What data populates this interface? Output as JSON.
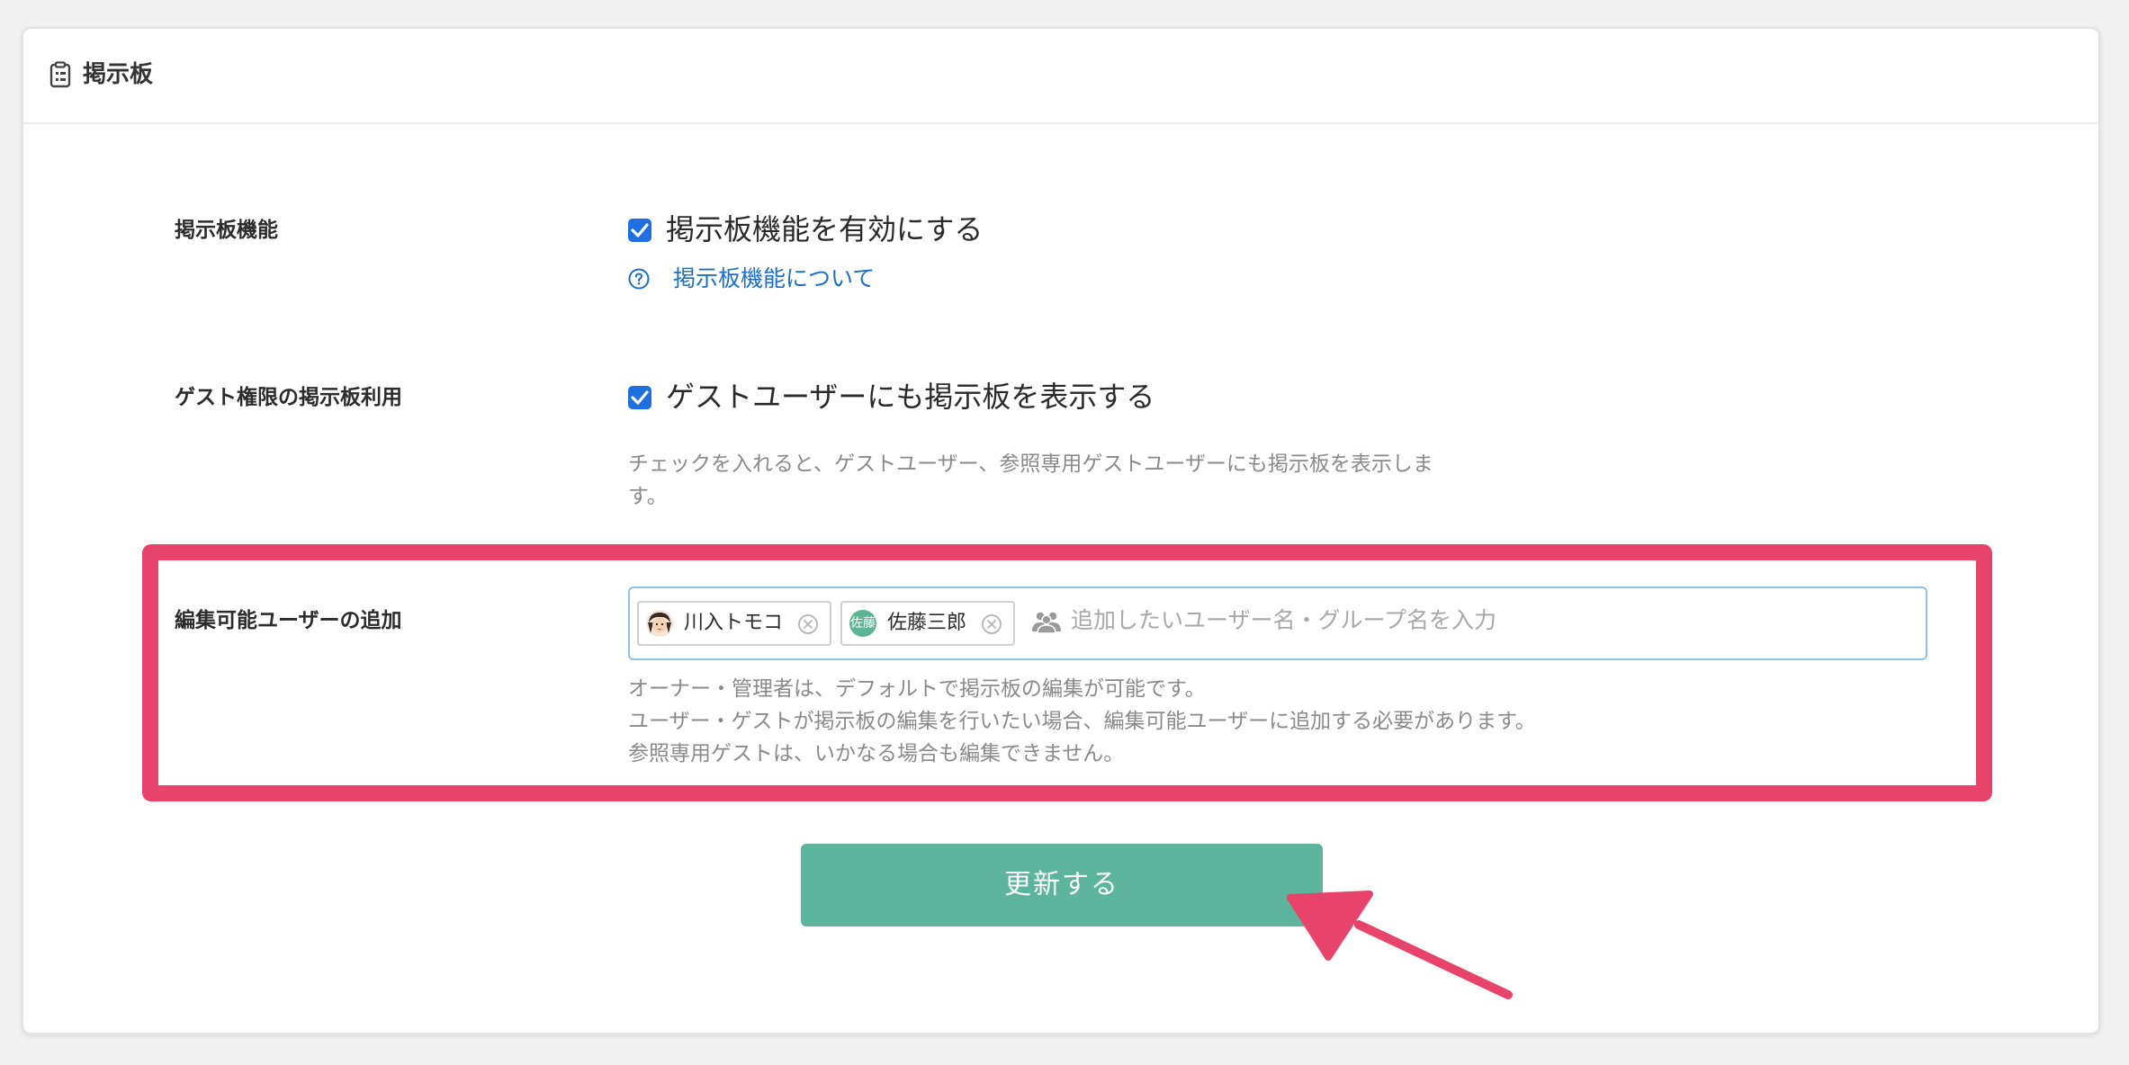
{
  "header": {
    "title": "掲示板",
    "icon": "clipboard-icon"
  },
  "rows": {
    "feature": {
      "label": "掲示板機能",
      "checkbox_label": "掲示板機能を有効にする",
      "checked": true,
      "help_link": "掲示板機能について"
    },
    "guest": {
      "label": "ゲスト権限の掲示板利用",
      "checkbox_label": "ゲストユーザーにも掲示板を表示する",
      "checked": true,
      "help_line1": "チェックを入れると、ゲストユーザー、参照専用ゲストユーザーにも掲示板を表示しま",
      "help_line2": "す。"
    },
    "editors": {
      "label": "編集可能ユーザーの追加",
      "tags": [
        {
          "name": "川入トモコ",
          "avatar": "face-avatar"
        },
        {
          "name": "佐藤三郎",
          "avatar_text": "佐藤"
        }
      ],
      "placeholder": "追加したいユーザー名・グループ名を入力",
      "help_line1": "オーナー・管理者は、デフォルトで掲示板の編集が可能です。",
      "help_line2": "ユーザー・ゲストが掲示板の編集を行いたい場合、編集可能ユーザーに追加する必要があります。",
      "help_line3": "参照専用ゲストは、いかなる場合も編集できません。"
    }
  },
  "submit": {
    "label": "更新する"
  },
  "colors": {
    "accent_highlight": "#e8436b",
    "button": "#5bb49b",
    "checkbox": "#1f6fe0",
    "link": "#1a6fc7"
  }
}
